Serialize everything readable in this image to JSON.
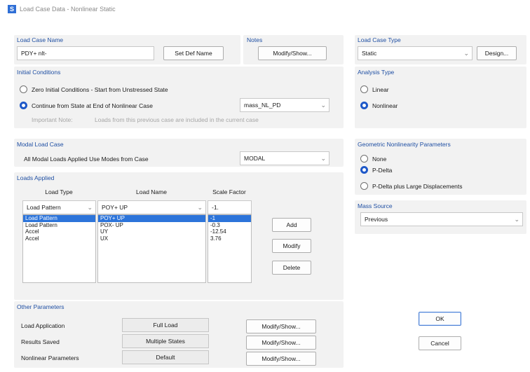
{
  "window": {
    "app_icon": "S",
    "title": "Load Case Data - Nonlinear Static"
  },
  "load_case_name": {
    "heading": "Load Case Name",
    "value": "PDY+ nlt-",
    "set_def_button": "Set Def Name"
  },
  "notes": {
    "heading": "Notes",
    "button": "Modify/Show..."
  },
  "load_case_type": {
    "heading": "Load Case Type",
    "value": "Static",
    "design_button": "Design..."
  },
  "initial_conditions": {
    "heading": "Initial Conditions",
    "option_zero": "Zero Initial Conditions - Start from Unstressed State",
    "option_continue": "Continue from State at End of Nonlinear Case",
    "selected": "continue",
    "continue_case": "mass_NL_PD",
    "note_label": "Important Note:",
    "note_text": "Loads from this previous case are included in the current case"
  },
  "analysis_type": {
    "heading": "Analysis Type",
    "options": [
      "Linear",
      "Nonlinear"
    ],
    "selected": "Nonlinear"
  },
  "modal_load_case": {
    "heading": "Modal Load Case",
    "label": "All Modal Loads Applied Use Modes from Case",
    "value": "MODAL"
  },
  "geometric_nonlinearity": {
    "heading": "Geometric Nonlinearity Parameters",
    "options": [
      "None",
      "P-Delta",
      "P-Delta plus Large Displacements"
    ],
    "selected": "P-Delta"
  },
  "loads_applied": {
    "heading": "Loads Applied",
    "col_load_type": "Load Type",
    "col_load_name": "Load Name",
    "col_scale_factor": "Scale Factor",
    "edit_row": {
      "load_type": "Load Pattern",
      "load_name": "POY+ UP",
      "scale_factor": "-1."
    },
    "rows": [
      {
        "load_type": "Load Pattern",
        "load_name": "POY+ UP",
        "scale_factor": "-1",
        "selected": true
      },
      {
        "load_type": "Load Pattern",
        "load_name": "POX- UP",
        "scale_factor": "-0.3",
        "selected": false
      },
      {
        "load_type": "Accel",
        "load_name": "UY",
        "scale_factor": "-12.54",
        "selected": false
      },
      {
        "load_type": "Accel",
        "load_name": "UX",
        "scale_factor": "3.76",
        "selected": false
      }
    ],
    "buttons": {
      "add": "Add",
      "modify": "Modify",
      "delete": "Delete"
    }
  },
  "mass_source": {
    "heading": "Mass Source",
    "value": "Previous"
  },
  "other_parameters": {
    "heading": "Other Parameters",
    "load_application": {
      "label": "Load Application",
      "value": "Full Load",
      "button": "Modify/Show..."
    },
    "results_saved": {
      "label": "Results Saved",
      "value": "Multiple States",
      "button": "Modify/Show..."
    },
    "nonlinear_parameters": {
      "label": "Nonlinear Parameters",
      "value": "Default",
      "button": "Modify/Show..."
    }
  },
  "dialog_buttons": {
    "ok": "OK",
    "cancel": "Cancel"
  },
  "colors": {
    "heading": "#1f4fa3",
    "selection": "#2c74da",
    "radio_on": "#1e58c8",
    "panel": "#f2f2f2"
  },
  "icons": {
    "dropdown": "chevron-down-icon",
    "radio": "radio-button-icon",
    "checkbox": "checkbox-icon"
  }
}
